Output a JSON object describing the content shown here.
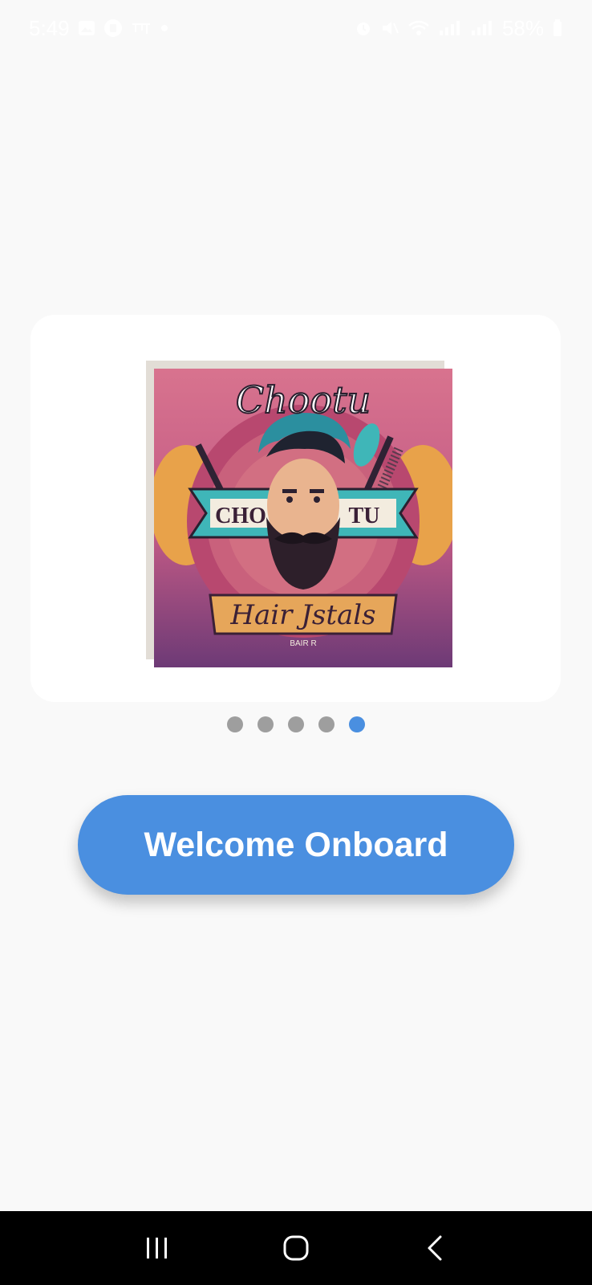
{
  "status_bar": {
    "time": "5:49",
    "battery": "58%",
    "icons": [
      "gallery-icon",
      "app-notification-icon",
      "sim-text-icon",
      "dot-icon",
      "alarm-icon",
      "mute-icon",
      "wifi-icon",
      "signal-icon",
      "signal-icon-2",
      "battery-icon"
    ]
  },
  "onboarding": {
    "slide_image": {
      "semantic": "barber-logo-illustration",
      "logo_text_top": "Chootu",
      "logo_banner_text": "CHO TU",
      "logo_bottom_text": "Hair Jstals",
      "logo_small_text": "BAIR R"
    },
    "pager": {
      "count": 5,
      "active_index": 4
    },
    "cta_label": "Welcome Onboard"
  },
  "nav_bar": {
    "buttons": [
      "recent-apps-icon",
      "home-icon",
      "back-icon"
    ]
  },
  "colors": {
    "accent": "#4a8fe0",
    "background": "#f9f9f9",
    "card": "#ffffff",
    "dot_inactive": "#9e9e9e"
  }
}
